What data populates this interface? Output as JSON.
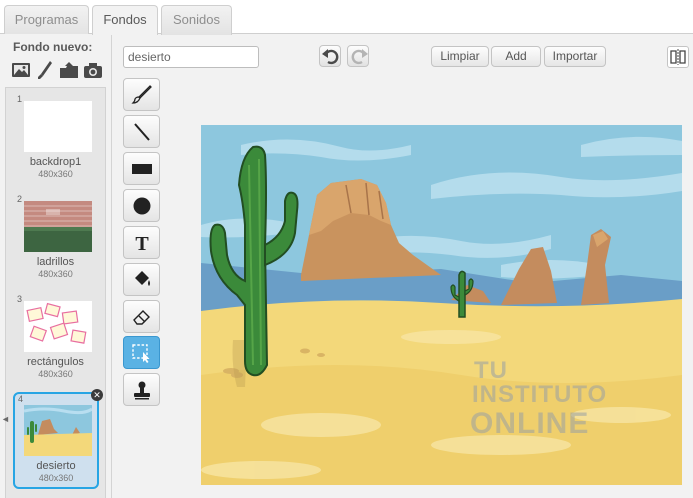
{
  "tabs": [
    {
      "label": "Programas"
    },
    {
      "label": "Fondos"
    },
    {
      "label": "Sonidos"
    }
  ],
  "sidebar": {
    "new_backdrop_label": "Fondo nuevo:",
    "new_icons": [
      "image-icon",
      "paintbrush-icon",
      "upload-icon",
      "camera-icon"
    ],
    "backdrops": [
      {
        "num": "1",
        "name": "backdrop1",
        "size": "480x360"
      },
      {
        "num": "2",
        "name": "ladrillos",
        "size": "480x360"
      },
      {
        "num": "3",
        "name": "rectángulos",
        "size": "480x360"
      },
      {
        "num": "4",
        "name": "desierto",
        "size": "480x360"
      }
    ]
  },
  "editor": {
    "name_value": "desierto",
    "buttons": {
      "clear": "Limpiar",
      "add": "Add",
      "import": "Importar"
    },
    "tools": [
      "paintbrush-tool",
      "line-tool",
      "rectangle-tool",
      "ellipse-tool",
      "text-tool",
      "fill-tool",
      "eraser-tool",
      "select-tool",
      "stamp-tool"
    ],
    "active_tool": "select-tool"
  },
  "watermark": {
    "line1": "TU",
    "line2": "INSTITUTO",
    "line3": "ONLINE"
  },
  "colors": {
    "accent": "#27a5e4",
    "selected_tool": "#5ab2e4",
    "sky": "#8dc7de",
    "sand": "#f3d87a"
  }
}
